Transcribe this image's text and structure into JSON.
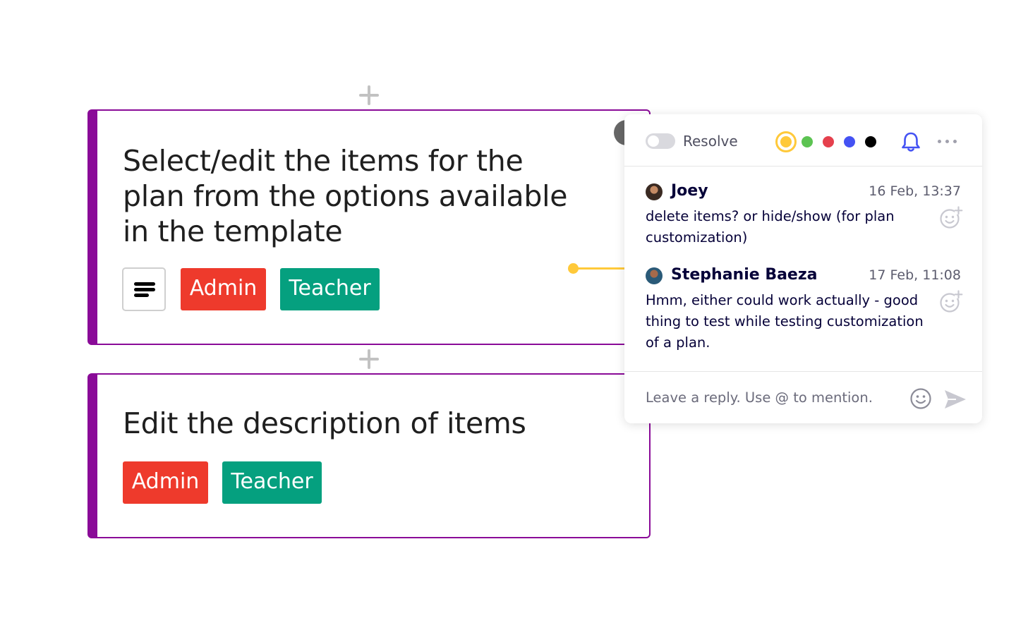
{
  "cards": [
    {
      "title": "Select/edit the items for the plan from the options available in the template",
      "tags": [
        "Admin",
        "Teacher"
      ]
    },
    {
      "title": "Edit the description of items",
      "tags": [
        "Admin",
        "Teacher"
      ]
    }
  ],
  "comment_panel": {
    "resolve_label": "Resolve",
    "colors": [
      "#ffc93a",
      "#5cc352",
      "#e5404d",
      "#4452f3",
      "#000000"
    ],
    "selected_color": "#ffc93a",
    "comments": [
      {
        "author": "Joey",
        "date": "16 Feb, 13:37",
        "text": "delete items? or hide/show (for plan customization)"
      },
      {
        "author": "Stephanie Baeza",
        "date": "17 Feb, 11:08",
        "text": "Hmm, either could work actually - good thing to test while testing customization of a plan."
      }
    ],
    "reply_placeholder": "Leave a reply. Use @ to mention."
  },
  "icons": {
    "add": "plus-icon",
    "description": "text-lines-icon",
    "notifications": "bell-icon",
    "more": "more-horizontal-icon",
    "reaction": "add-reaction-icon",
    "emoji": "emoji-icon",
    "send": "send-icon"
  },
  "colors": {
    "card_border": "#8a0b98",
    "admin_tag": "#ee3a2c",
    "teacher_tag": "#05a07f",
    "connector": "#ffc93a",
    "accent": "#4452f3"
  }
}
